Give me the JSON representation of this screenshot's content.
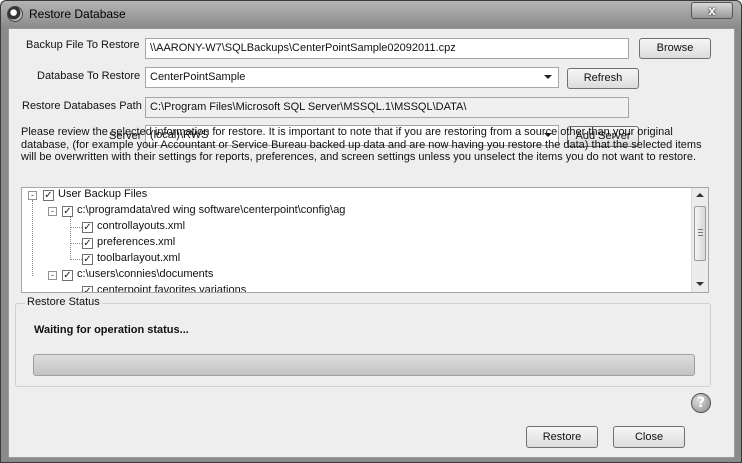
{
  "window": {
    "title": "Restore Database",
    "close_glyph": "x"
  },
  "form": {
    "backup_label": "Backup File To Restore",
    "backup_value": "\\\\AARONY-W7\\SQLBackups\\CenterPointSample02092011.cpz",
    "browse_label": "Browse",
    "database_label": "Database To Restore",
    "database_value": "CenterPointSample",
    "refresh_label": "Refresh",
    "path_label": "Restore Databases Path",
    "path_value": "C:\\Program Files\\Microsoft SQL Server\\MSSQL.1\\MSSQL\\DATA\\",
    "server_label": "Server",
    "server_value": "(local)\\RWS",
    "add_server_label": "Add Server"
  },
  "info_text": "Please review the selected information for restore. It is important to note that if you are restoring from a source other than your original database, (for example your Accountant or Service Bureau backed up data and are now having you restore the data) that the selected items will be overwritten with their settings for reports, preferences, and screen settings unless you unselect the items you do not want to restore.",
  "tree": {
    "items": [
      {
        "label": "User Backup Files",
        "checked": true,
        "toggle": "-"
      },
      {
        "label": "c:\\programdata\\red wing software\\centerpoint\\config\\ag",
        "checked": true,
        "toggle": "-"
      },
      {
        "label": "controllayouts.xml",
        "checked": true
      },
      {
        "label": "preferences.xml",
        "checked": true
      },
      {
        "label": "toolbarlayout.xml",
        "checked": true
      },
      {
        "label": "c:\\users\\connies\\documents",
        "checked": true,
        "toggle": "-"
      },
      {
        "label": "centerpoint favorites variations",
        "checked": true
      }
    ],
    "check_glyph": "✓"
  },
  "status": {
    "group_title": "Restore Status",
    "message": "Waiting for operation status...",
    "progress": 0
  },
  "buttons": {
    "restore": "Restore",
    "close": "Close"
  },
  "help_glyph": "?"
}
